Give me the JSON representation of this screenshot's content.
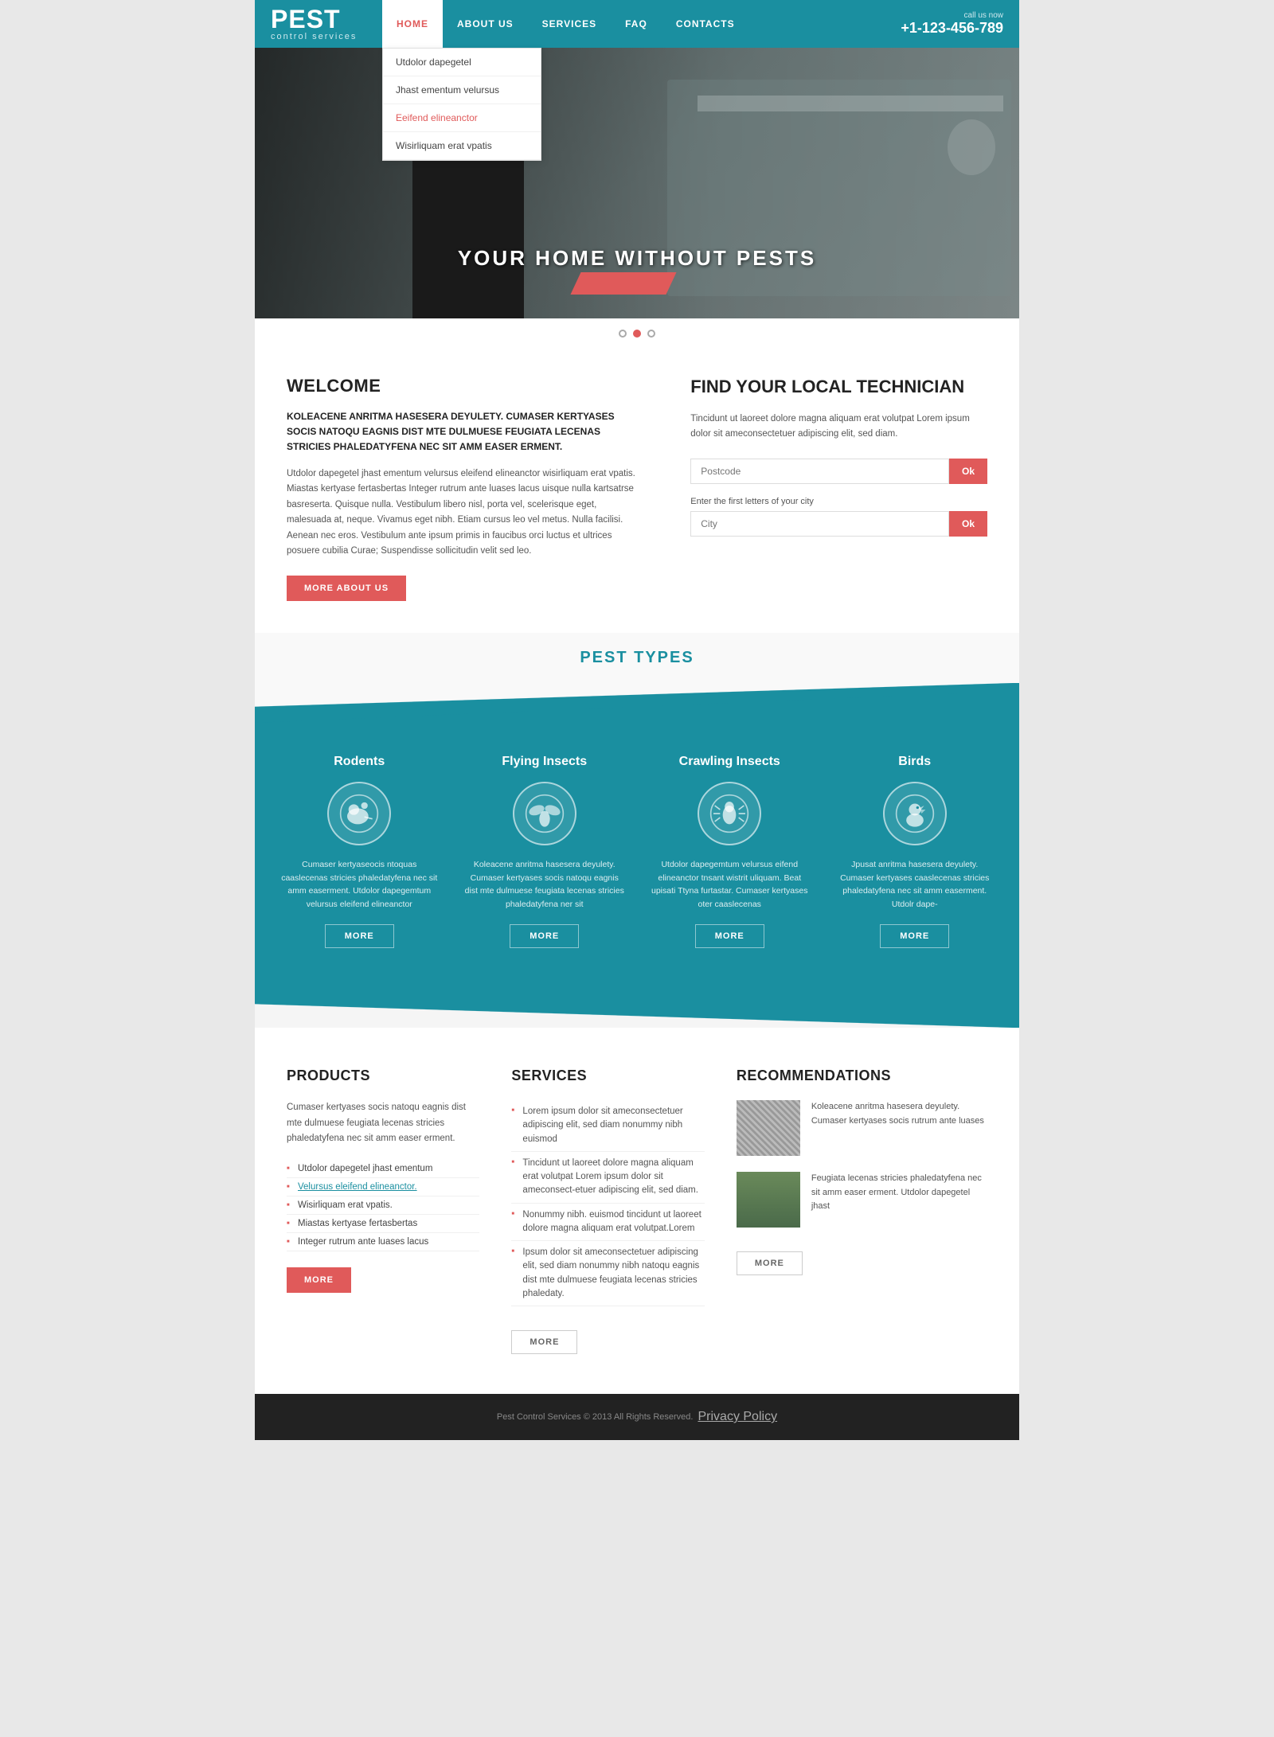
{
  "brand": {
    "name": "PEST",
    "tagline": "control services"
  },
  "header": {
    "nav": [
      {
        "label": "HOME",
        "active": true
      },
      {
        "label": "ABOUT US",
        "active": false
      },
      {
        "label": "SERVICES",
        "active": false
      },
      {
        "label": "FAQ",
        "active": false
      },
      {
        "label": "CONTACTS",
        "active": false
      }
    ],
    "call_label": "call us now",
    "call_number": "+1-123-456-789"
  },
  "dropdown": {
    "items": [
      {
        "label": "Utdolor dapegetel",
        "highlighted": false
      },
      {
        "label": "Jhast ementum velursus",
        "highlighted": false
      },
      {
        "label": "Eeifend elineanctor",
        "highlighted": true
      },
      {
        "label": "Wisirliquam erat vpatis",
        "highlighted": false
      }
    ]
  },
  "hero": {
    "title": "YOUR HOME WITHOUT PESTS",
    "dots": [
      {
        "active": true
      },
      {
        "active": false
      },
      {
        "active": false
      }
    ]
  },
  "welcome": {
    "title": "WELCOME",
    "bold_text": "KOLEACENE ANRITMA HASESERA DEYULETY. CUMASER KERTYASES SOCIS NATOQU EAGNIS DIST MTE DULMUESE FEUGIATA LECENAS STRICIES PHALEDATYFENA NEC SIT AMM EASER ERMENT.",
    "text": "Utdolor dapegetel jhast ementum velursus eleifend elineanctor wisirliquam erat vpatis. Miastas kertyase fertasbertas Integer rutrum ante luases lacus uisque nulla kartsatrse basreserta. Quisque nulla. Vestibulum libero nisl, porta vel, scelerisque eget, malesuada at, neque. Vivamus eget nibh. Etiam cursus leo vel metus. Nulla facilisi. Aenean nec eros. Vestibulum ante ipsum primis in faucibus orci luctus et ultrices posuere cubilia Curae; Suspendisse sollicitudin velit sed leo.",
    "btn_label": "MORE ABOUT US"
  },
  "find": {
    "title": "FIND YOUR LOCAL TECHNICIAN",
    "desc": "Tincidunt ut laoreet dolore magna aliquam erat volutpat Lorem ipsum dolor sit ameconsectetuer adipiscing elit, sed diam.",
    "postcode_placeholder": "Postcode",
    "postcode_btn": "Ok",
    "city_label": "Enter the first letters of your city",
    "city_placeholder": "City",
    "city_btn": "Ok"
  },
  "pest_types": {
    "heading": "PEST TYPES",
    "items": [
      {
        "title": "Rodents",
        "text": "Cumaser kertyaseocis ntoquas caaslecenas stricies phaledatyfena nec sit amm easerment. Utdolor dapegemtum velursus eleifend elineanctor",
        "btn": "MORE",
        "icon": "rodent"
      },
      {
        "title": "Flying Insects",
        "text": "Koleacene anritma hasesera deyulety. Cumaser kertyases socis natoqu eagnis dist mte dulmuese feugiata lecenas stricies phaledatyfena ner sit",
        "btn": "MORE",
        "icon": "flying"
      },
      {
        "title": "Crawling Insects",
        "text": "Utdolor dapegemtum velursus eifend elineanctor tnsant wistrit uliquam. Beat upisati Ttyna furtastar. Cumaser kertyases oter caaslecenas",
        "btn": "MORE",
        "icon": "crawling"
      },
      {
        "title": "Birds",
        "text": "Jpusat anritma hasesera deyulety. Cumaser kertyases caaslecenas stricies phaledatyfena nec sit amm easerment. Utdolr dape-",
        "btn": "MORE",
        "icon": "bird"
      }
    ]
  },
  "products": {
    "title": "PRODUCTS",
    "desc": "Cumaser kertyases socis natoqu eagnis dist mte dulmuese feugiata lecenas stricies phaledatyfena nec sit amm easer erment.",
    "list": [
      {
        "text": "Utdolor dapegetel jhast ementum",
        "link": false
      },
      {
        "text": "Velursus eleifend elineanctor.",
        "link": true
      },
      {
        "text": "Wisirliquam erat vpatis.",
        "link": false
      },
      {
        "text": "Miastas kertyase fertasbertas",
        "link": false
      },
      {
        "text": "Integer rutrum ante luases lacus",
        "link": false
      }
    ],
    "btn_label": "MORE"
  },
  "services": {
    "title": "SERVICES",
    "list": [
      "Lorem ipsum dolor sit ameconsectetuer adipiscing elit, sed diam nonummy nibh euismod",
      "Tincidunt ut laoreet dolore magna aliquam erat volutpat Lorem ipsum dolor sit ameconsect-etuer adipiscing elit, sed diam.",
      "Nonummy nibh. euismod tincidunt ut laoreet dolore magna aliquam erat volutpat.Lorem",
      "Ipsum dolor sit ameconsectetuer adipiscing elit, sed diam nonummy nibh natoqu eagnis dist mte dulmuese feugiata lecenas stricies phaledaty."
    ],
    "btn_label": "MORE"
  },
  "recommendations": {
    "title": "RECOMMENDATIONS",
    "items": [
      {
        "text": "Koleacene anritma hasesera deyulety. Cumaser kertyases socis rutrum ante luases",
        "img_type": "mesh"
      },
      {
        "text": "Feugiata lecenas stricies phaledatyfena nec sit amm easer erment. Utdolor dapegetel jhast",
        "img_type": "woman"
      }
    ],
    "btn_label": "MORE"
  },
  "footer": {
    "text": "Pest Control Services © 2013 All Rights Reserved.",
    "policy_link": "Privacy Policy"
  },
  "colors": {
    "teal": "#1a8fa0",
    "red": "#e05a5a",
    "dark": "#222222",
    "light_bg": "#f5f5f5"
  }
}
